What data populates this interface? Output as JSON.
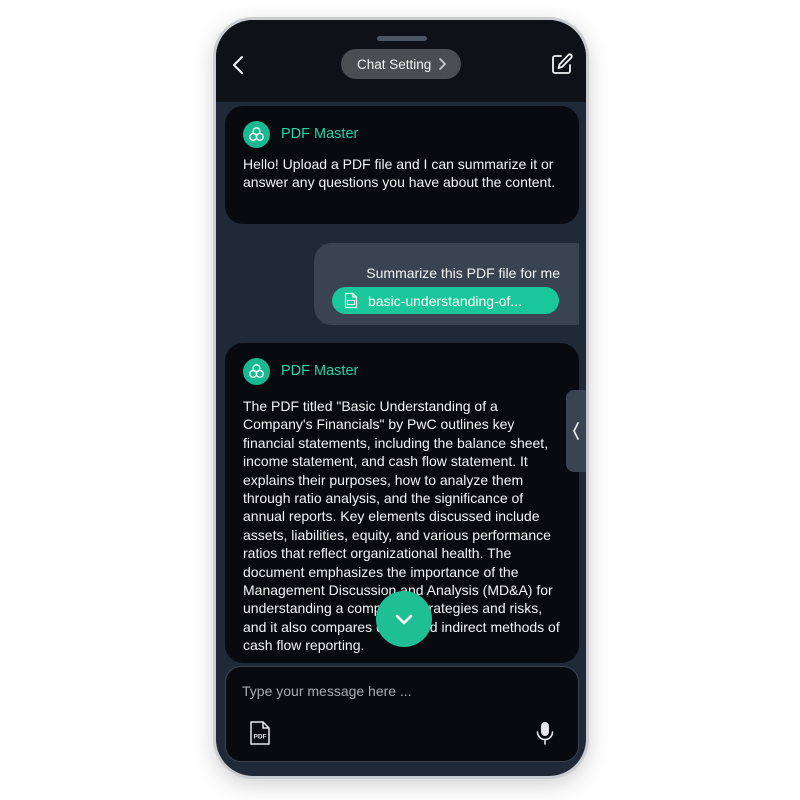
{
  "header": {
    "back_icon": "chevron-left-icon",
    "chat_setting_label": "Chat Setting",
    "edit_icon": "edit-icon"
  },
  "messages": [
    {
      "role": "bot",
      "name": "PDF Master",
      "avatar_icon": "pdf-master-logo",
      "text": "Hello! Upload a PDF file and I can summarize it or answer any questions you have about the content."
    },
    {
      "role": "user",
      "text": "Summarize this PDF file for me",
      "file_name": "basic-understanding-of...",
      "file_icon": "pdf-file-icon"
    },
    {
      "role": "bot",
      "name": "PDF Master",
      "avatar_icon": "pdf-master-logo",
      "text": "The PDF titled \"Basic Understanding of a Company's Financials\" by PwC outlines key financial statements, including the balance sheet, income statement, and cash flow statement. It explains their purposes, how to analyze them through ratio analysis, and the significance of annual reports. Key elements discussed include assets, liabilities, equity, and various performance ratios that reflect organizational health. The document emphasizes the importance of the Management Discussion and Analysis (MD&A) for understanding a company's strategies and risks, and it also compares direct and indirect methods of cash flow reporting."
    }
  ],
  "composer": {
    "placeholder": "Type your message here ...",
    "pdf_icon": "pdf-upload-icon",
    "mic_icon": "microphone-icon"
  },
  "colors": {
    "accent": "#1fbf95",
    "accent_text": "#25d3a6",
    "background": "#202938",
    "bubble_bot": "#070a0f",
    "bubble_user": "#3a4352"
  }
}
